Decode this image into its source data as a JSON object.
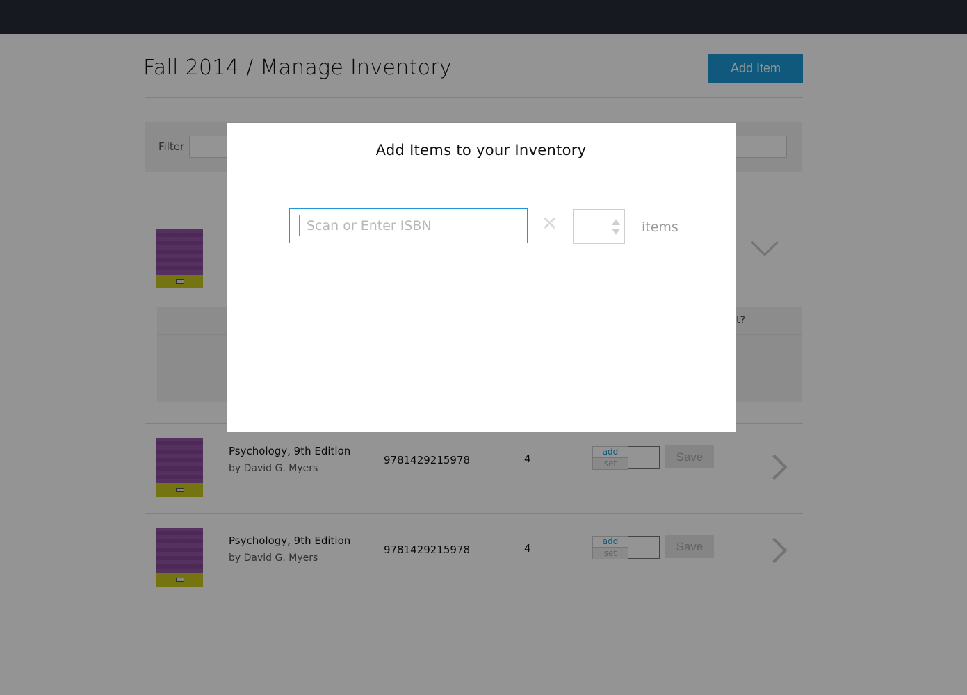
{
  "page": {
    "title": "Fall 2014 / Manage Inventory",
    "add_item_label": "Add Item"
  },
  "filter": {
    "label": "Filter",
    "value": ""
  },
  "expanded_row": {
    "detail_question_fragment": "it?"
  },
  "rows": [
    {
      "title": "Psychology, 9th Edition",
      "author": "by David G. Myers",
      "isbn": "9781429215978",
      "quantity": "4",
      "toggle_add": "add",
      "toggle_set": "set",
      "save_label": "Save"
    },
    {
      "title": "Psychology, 9th Edition",
      "author": "by David G. Myers",
      "isbn": "9781429215978",
      "quantity": "4",
      "toggle_add": "add",
      "toggle_set": "set",
      "save_label": "Save"
    }
  ],
  "modal": {
    "title": "Add Items to your Inventory",
    "isbn_placeholder": "Scan or Enter ISBN",
    "isbn_value": "",
    "clear_symbol": "✕",
    "count_value": "",
    "items_label": "items"
  }
}
